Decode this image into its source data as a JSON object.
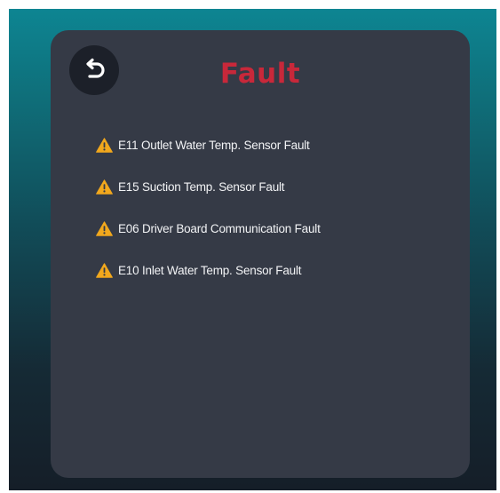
{
  "screen": {
    "title": "Fault",
    "back_icon": "undo-arrow-icon",
    "colors": {
      "title": "#c8283a",
      "panel": "#353a46",
      "warning": "#f2a81d",
      "text": "#f2f3f5"
    }
  },
  "faults": [
    {
      "icon": "warning-triangle-icon",
      "text": "E11 Outlet Water Temp. Sensor Fault"
    },
    {
      "icon": "warning-triangle-icon",
      "text": "E15 Suction Temp. Sensor Fault"
    },
    {
      "icon": "warning-triangle-icon",
      "text": "E06 Driver Board Communication Fault"
    },
    {
      "icon": "warning-triangle-icon",
      "text": "E10 Inlet Water Temp. Sensor Fault"
    }
  ]
}
